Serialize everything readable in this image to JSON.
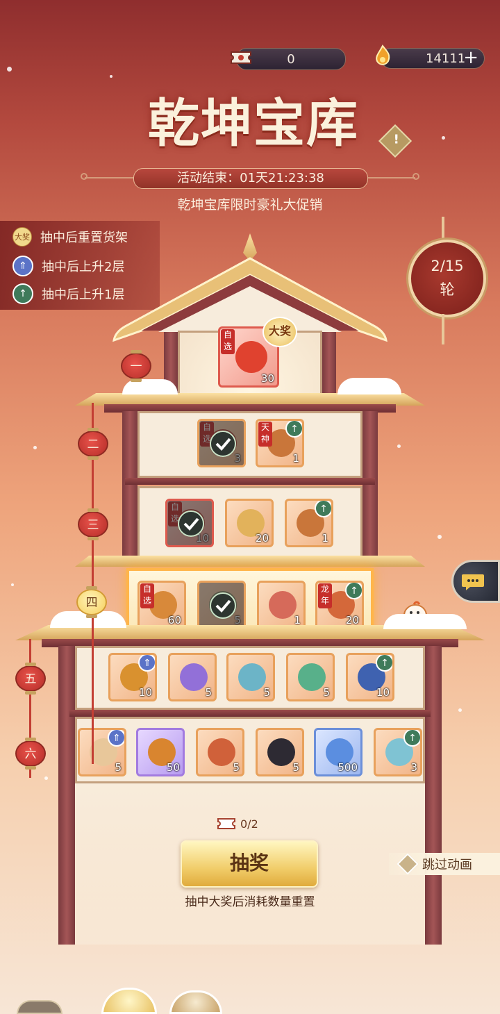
{
  "header": {
    "currency_ticket": {
      "icon": "ticket-icon",
      "value": "0"
    },
    "currency_coin": {
      "icon": "flame-coin-icon",
      "value": "14111",
      "add_label": "+"
    },
    "title": "乾坤宝库",
    "help_label": "!",
    "timer": "活动结束：01天21:23:38",
    "subtitle": "乾坤宝库限时豪礼大促销"
  },
  "legend": [
    {
      "icon": "grand-prize-icon",
      "badge": "大奖",
      "label": "抽中后重置货架",
      "color": "#e3c46a"
    },
    {
      "icon": "double-arrow-up-icon",
      "badge": "⇑",
      "label": "抽中后上升2层",
      "color": "#5b73c7"
    },
    {
      "icon": "arrow-up-icon",
      "badge": "↑",
      "label": "抽中后上升1层",
      "color": "#3f7a5a"
    }
  ],
  "round": {
    "progress": "2/15",
    "unit": "轮"
  },
  "floors": {
    "f1": {
      "label": "一",
      "grand_badge": "大奖",
      "items": [
        {
          "count": "30",
          "tag": "自选",
          "art": "#e0422f"
        }
      ]
    },
    "f2": {
      "label": "二",
      "items": [
        {
          "count": "3",
          "tag": "自选",
          "done": true,
          "art": "#b4473a"
        },
        {
          "count": "1",
          "tag": "天神",
          "up": "1",
          "art": "#c9763a"
        }
      ]
    },
    "f3": {
      "label": "三",
      "items": [
        {
          "count": "10",
          "tag": "自选",
          "done": true,
          "art": "#b4473a",
          "rarity": "red"
        },
        {
          "count": "20",
          "art": "#e2b25b"
        },
        {
          "count": "1",
          "up": "1",
          "art": "#c9763a"
        }
      ]
    },
    "f4": {
      "label": "四",
      "active": true,
      "items": [
        {
          "count": "60",
          "tag": "自选",
          "art": "#d8893a"
        },
        {
          "count": "5",
          "done": true,
          "art": "#8b8f6a"
        },
        {
          "count": "1",
          "art": "#d66a5a"
        },
        {
          "count": "20",
          "tag": "龙年",
          "up": "1",
          "art": "#d4683a"
        }
      ]
    },
    "f5": {
      "label": "五",
      "items": [
        {
          "count": "10",
          "up": "2",
          "art": "#d9912f"
        },
        {
          "count": "5",
          "art": "#9270d8"
        },
        {
          "count": "5",
          "art": "#6cb4c7"
        },
        {
          "count": "5",
          "art": "#58b08a"
        },
        {
          "count": "10",
          "up": "1",
          "art": "#3f62b0"
        }
      ]
    },
    "f6": {
      "label": "六",
      "items": [
        {
          "count": "5",
          "up": "2",
          "art": "#e8c79a"
        },
        {
          "count": "50",
          "rarity": "purple",
          "art": "#d9852f"
        },
        {
          "count": "5",
          "art": "#d0613a"
        },
        {
          "count": "5",
          "art": "#2d2a33"
        },
        {
          "count": "500",
          "rarity": "blue",
          "art": "#5b8ee0"
        },
        {
          "count": "3",
          "up": "1",
          "art": "#7fc3d3"
        }
      ]
    }
  },
  "draw": {
    "cost_icon": "ticket-icon",
    "cost": "0/2",
    "button": "抽奖",
    "note": "抽中大奖后消耗数量重置"
  },
  "skip_label": "跳过动画",
  "chat_icon": "chat-bubble-icon"
}
